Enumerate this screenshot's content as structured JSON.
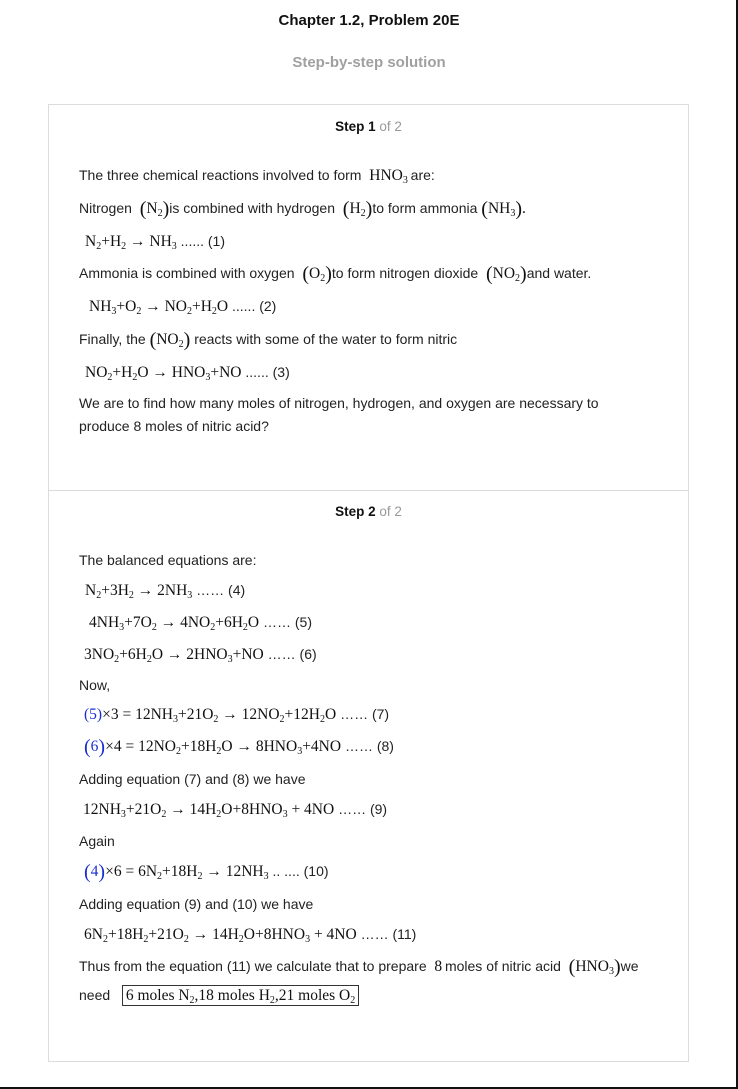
{
  "header": {
    "title": "Chapter 1.2, Problem 20E",
    "subtitle": "Step-by-step solution"
  },
  "step1": {
    "label": "Step 1",
    "of": " of 2",
    "intro": "The three chemical reactions involved to form",
    "intro_end": "are:",
    "nitrogen_a": "Nitrogen",
    "nitrogen_b": "is combined with hydrogen",
    "nitrogen_c": "to form ammonia",
    "eq1_label": "...... (1)",
    "ammonia_a": "Ammonia is combined with oxygen",
    "ammonia_b": "to form nitrogen dioxide",
    "ammonia_c": "and water.",
    "eq2_label": "...... (2)",
    "finally_a": "Finally, the",
    "finally_b": "reacts with some of the water to form nitric",
    "eq3_label": "...... (3)",
    "question_1": "We are to find how many moles of nitrogen, hydrogen, and oxygen are necessary to",
    "question_2": "produce 8 moles of nitric acid?"
  },
  "step2": {
    "label": "Step 2",
    "of": " of 2",
    "balanced": "The balanced equations are:",
    "eq4_label": "…… (4)",
    "eq5_label": "…… (5)",
    "eq6_label": "…… (6)",
    "now": "Now,",
    "eq7_ref": "5",
    "eq7_label": "…… (7)",
    "eq8_ref": "6",
    "eq8_label": "…… (8)",
    "adding_78": "Adding equation (7) and (8) we have",
    "eq9_label": "…… (9)",
    "again": "Again",
    "eq10_ref": "4",
    "eq10_label": ".. .... (10)",
    "adding_910": "Adding equation (9) and (10) we have",
    "eq11_label": "…… (11)",
    "thus_a": "Thus from the equation (11) we calculate that to prepare",
    "thus_num": "8",
    "thus_b": "moles of nitric acid",
    "thus_c": "we",
    "need": "need",
    "answer": {
      "moles_n": "6 moles N",
      "moles_h": ",18 moles H",
      "moles_o": ",21 moles O"
    }
  }
}
